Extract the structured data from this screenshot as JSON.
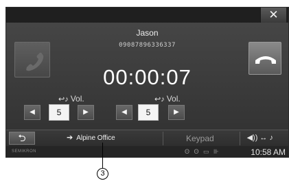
{
  "header": {
    "close_glyph": "✕"
  },
  "call": {
    "contact_name": "Jason",
    "phone_number": "09087896336337",
    "elapsed_time": "00:00:07"
  },
  "volume": {
    "left": {
      "label": "Vol.",
      "value": "5"
    },
    "right": {
      "label": "Vol.",
      "value": "5"
    }
  },
  "bottom": {
    "back_glyph": "⮌",
    "forward_label": "Alpine Office",
    "keypad_label": "Keypad"
  },
  "status": {
    "brand": "SEMIKRON",
    "time": "10:58 AM"
  },
  "callout": {
    "number": "3"
  }
}
